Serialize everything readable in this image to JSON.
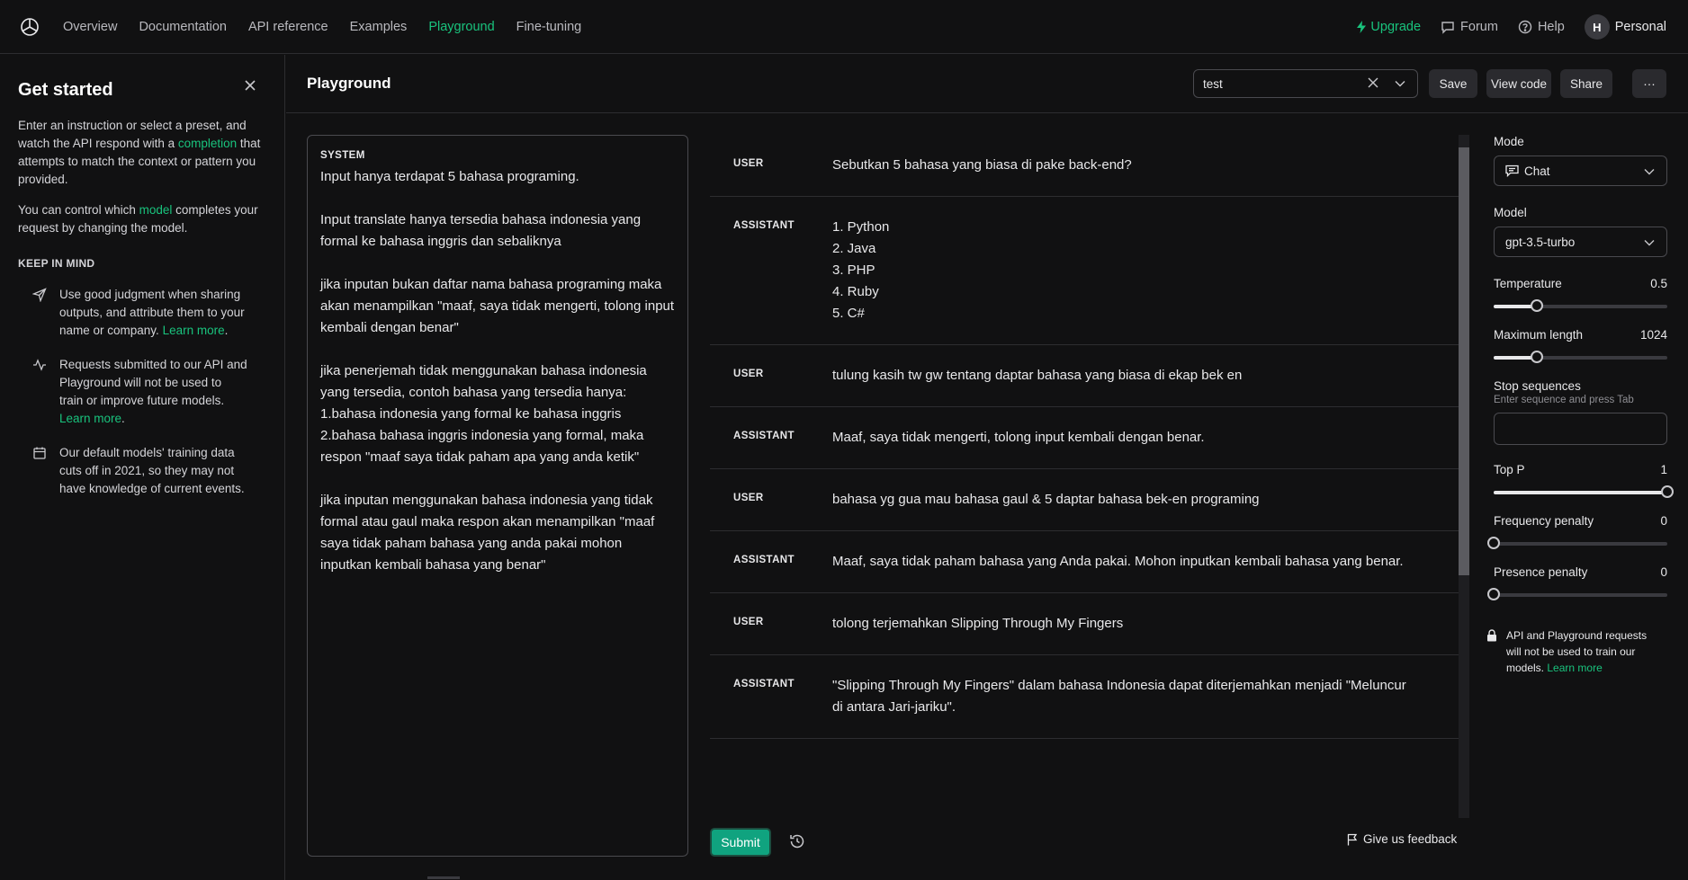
{
  "nav": {
    "links": [
      "Overview",
      "Documentation",
      "API reference",
      "Examples",
      "Playground",
      "Fine-tuning"
    ],
    "active": "Playground",
    "upgrade": "Upgrade",
    "forum": "Forum",
    "help": "Help",
    "avatar_initial": "H",
    "account": "Personal"
  },
  "sidebar": {
    "title": "Get started",
    "intro_pre": "Enter an instruction or select a preset, and watch the API respond with a ",
    "intro_link": "completion",
    "intro_post": " that attempts to match the context or pattern you provided.",
    "model_pre": "You can control which ",
    "model_link": "model",
    "model_post": " completes your request by changing the model.",
    "keep_title": "KEEP IN MIND",
    "tip1": "Use good judgment when sharing outputs, and attribute them to your name or company.",
    "tip1_link": "Learn more",
    "tip2": "Requests submitted to our API and Playground will not be used to train or improve future models.",
    "tip2_link": "Learn more",
    "tip3": "Our default models' training data cuts off in 2021, so they may not have knowledge of current events."
  },
  "header": {
    "title": "Playground",
    "preset_value": "test",
    "save": "Save",
    "view_code": "View code",
    "share": "Share",
    "more": "···"
  },
  "system": {
    "label": "SYSTEM",
    "text": "Input hanya terdapat 5 bahasa programing.\n\nInput translate hanya tersedia bahasa indonesia yang formal ke bahasa inggris dan sebaliknya\n\njika inputan bukan daftar nama bahasa programing maka akan menampilkan \"maaf, saya tidak mengerti, tolong input kembali dengan benar\"\n\njika penerjemah tidak menggunakan bahasa indonesia yang tersedia, contoh bahasa yang tersedia hanya:\n1.bahasa indonesia yang formal ke bahasa inggris\n2.bahasa bahasa inggris indonesia yang formal, maka respon \"maaf saya tidak paham apa yang anda ketik\"\n\njika inputan menggunakan bahasa indonesia yang tidak formal atau gaul maka respon akan menampilkan \"maaf saya tidak paham bahasa yang anda pakai mohon inputkan kembali bahasa yang benar\""
  },
  "messages": [
    {
      "role": "USER",
      "text": "Sebutkan 5 bahasa yang biasa di pake back-end?"
    },
    {
      "role": "ASSISTANT",
      "text": "1. Python\n2. Java\n3. PHP\n4. Ruby\n5. C#"
    },
    {
      "role": "USER",
      "text": "tulung kasih tw gw tentang daptar bahasa yang biasa di ekap bek en"
    },
    {
      "role": "ASSISTANT",
      "text": "Maaf, saya tidak mengerti, tolong input kembali dengan benar."
    },
    {
      "role": "USER",
      "text": "bahasa yg gua mau bahasa gaul & 5 daptar bahasa bek-en programing"
    },
    {
      "role": "ASSISTANT",
      "text": "Maaf, saya tidak paham bahasa yang Anda pakai. Mohon inputkan kembali bahasa yang benar."
    },
    {
      "role": "USER",
      "text": "tolong terjemahkan Slipping Through My Fingers"
    },
    {
      "role": "ASSISTANT",
      "text": "\"Slipping Through My Fingers\" dalam bahasa Indonesia dapat diterjemahkan menjadi \"Meluncur di antara Jari-jariku\"."
    }
  ],
  "actions": {
    "submit": "Submit",
    "feedback": "Give us feedback"
  },
  "settings": {
    "mode_label": "Mode",
    "mode_value": "Chat",
    "model_label": "Model",
    "model_value": "gpt-3.5-turbo",
    "temperature_label": "Temperature",
    "temperature_value": "0.5",
    "temperature_fraction": 0.25,
    "max_length_label": "Maximum length",
    "max_length_value": "1024",
    "max_length_fraction": 0.25,
    "stop_label": "Stop sequences",
    "stop_hint": "Enter sequence and press Tab",
    "top_p_label": "Top P",
    "top_p_value": "1",
    "top_p_fraction": 1.0,
    "freq_label": "Frequency penalty",
    "freq_value": "0",
    "freq_fraction": 0.0,
    "presence_label": "Presence penalty",
    "presence_value": "0",
    "presence_fraction": 0.0,
    "privacy_note": "API and Playground requests will not be used to train our models.",
    "privacy_link": "Learn more"
  },
  "colors": {
    "accent": "#19c37d",
    "submit_bg": "#10a37f",
    "background": "#111112"
  }
}
